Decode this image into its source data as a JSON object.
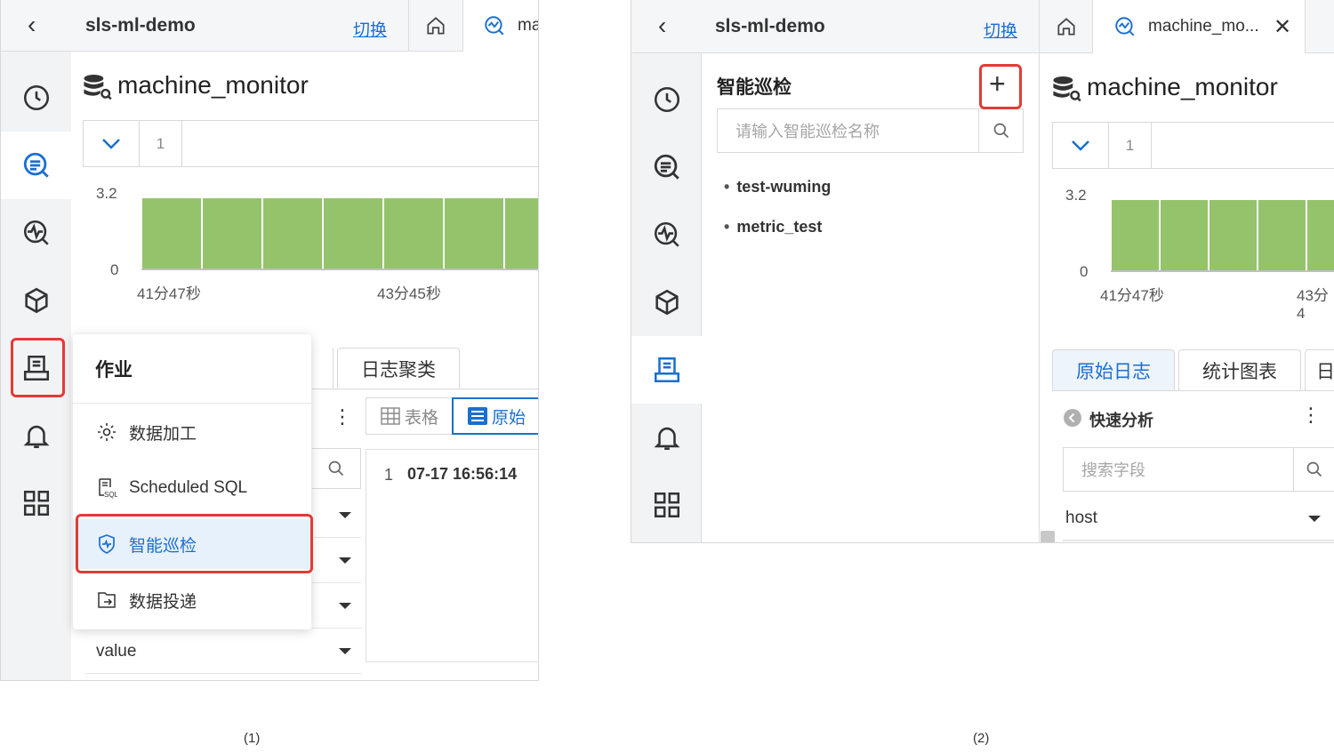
{
  "captions": {
    "left": "(1)",
    "right": "(2)"
  },
  "header": {
    "project": "sls-ml-demo",
    "switch_label": "切换",
    "tab_truncated_left": "ma",
    "tab_right": "machine_mo..."
  },
  "logstore": {
    "name": "machine_monitor",
    "line_number": "1"
  },
  "histogram": {
    "y_max": "3.2",
    "y_min": "0",
    "x_ticks": [
      "41分47秒",
      "43分45秒"
    ],
    "x_ticks_right": [
      "41分47秒",
      "43分4"
    ]
  },
  "panel1": {
    "tab_log_cluster": "日志聚类",
    "view_table": "表格",
    "view_raw": "原始",
    "log_row_number": "1",
    "log_time": "07-17 16:56:14",
    "field_value": "value"
  },
  "job_menu": {
    "title": "作业",
    "items": [
      {
        "label": "数据加工",
        "icon": "gear-icon"
      },
      {
        "label": "Scheduled SQL",
        "icon": "sql-icon"
      },
      {
        "label": "智能巡检",
        "icon": "inspection-icon"
      },
      {
        "label": "数据投递",
        "icon": "export-icon"
      }
    ]
  },
  "inspection_panel": {
    "title": "智能巡检",
    "search_placeholder": "请输入智能巡检名称",
    "items": [
      "test-wuming",
      "metric_test"
    ]
  },
  "panel2": {
    "tabs": [
      "原始日志",
      "统计图表",
      "日"
    ],
    "quick_analysis": "快速分析",
    "field_search_placeholder": "搜索字段",
    "field_host": "host"
  },
  "colors": {
    "accent": "#1a6fd1",
    "bar": "#94c36c",
    "highlight": "#e23b36"
  }
}
